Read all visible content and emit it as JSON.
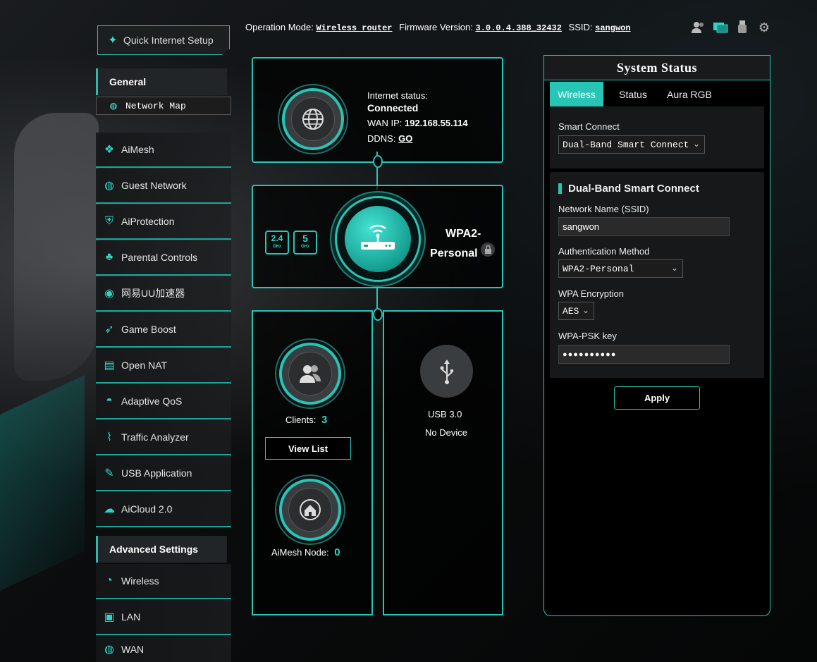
{
  "header": {
    "op_mode_label": "Operation Mode:",
    "op_mode_value": "Wireless router",
    "firmware_label": "Firmware Version:",
    "firmware_value": "3.0.0.4.388_32432",
    "ssid_label": "SSID:",
    "ssid_value": "sangwon",
    "icons": [
      "users-icon",
      "monitor-icon",
      "usb-icon",
      "gear-icon"
    ]
  },
  "menu": {
    "quick_setup": "Quick Internet Setup",
    "general_header": "General",
    "general_items": [
      {
        "label": "Network Map",
        "icon": "globe-icon"
      },
      {
        "label": "AiMesh",
        "icon": "mesh-icon"
      },
      {
        "label": "Guest Network",
        "icon": "guest-globe-icon"
      },
      {
        "label": "AiProtection",
        "icon": "shield-icon"
      },
      {
        "label": "Parental Controls",
        "icon": "family-icon"
      },
      {
        "label": "网易UU加速器",
        "icon": "uu-icon"
      },
      {
        "label": "Game Boost",
        "icon": "rocket-icon"
      },
      {
        "label": "Open NAT",
        "icon": "nat-icon"
      },
      {
        "label": "Adaptive QoS",
        "icon": "gauge-icon"
      },
      {
        "label": "Traffic Analyzer",
        "icon": "traffic-icon"
      },
      {
        "label": "USB Application",
        "icon": "usb-app-icon"
      },
      {
        "label": "AiCloud 2.0",
        "icon": "cloud-icon"
      }
    ],
    "advanced_header": "Advanced Settings",
    "advanced_items": [
      {
        "label": "Wireless",
        "icon": "wifi-icon"
      },
      {
        "label": "LAN",
        "icon": "lan-icon"
      },
      {
        "label": "WAN",
        "icon": "wan-globe-icon"
      }
    ]
  },
  "network_map": {
    "internet_status_label": "Internet status:",
    "internet_status_value": "Connected",
    "wan_ip_label": "WAN IP:",
    "wan_ip_value": "192.168.55.114",
    "ddns_label": "DDNS:",
    "ddns_value": "GO",
    "band_24": "2.4",
    "band_24_unit": "GHz",
    "band_5": "5",
    "band_5_unit": "GHz",
    "security_line1": "WPA2-",
    "security_line2": "Personal",
    "clients_label": "Clients:",
    "clients_value": "3",
    "view_list": "View List",
    "aimesh_label": "AiMesh Node:",
    "aimesh_value": "0",
    "usb_label": "USB 3.0",
    "usb_status": "No Device"
  },
  "system_status": {
    "title": "System Status",
    "tabs": [
      "Wireless",
      "Status",
      "Aura RGB"
    ],
    "smart_connect_label": "Smart Connect",
    "smart_connect_value": "Dual-Band Smart Connect",
    "section_title": "Dual-Band Smart Connect",
    "ssid_label": "Network Name (SSID)",
    "ssid_value": "sangwon",
    "auth_label": "Authentication Method",
    "auth_value": "WPA2-Personal",
    "enc_label": "WPA Encryption",
    "enc_value": "AES",
    "psk_label": "WPA-PSK key",
    "psk_value": "●●●●●●●●●●",
    "apply": "Apply"
  },
  "colors": {
    "accent": "#27c5b5",
    "accent_bright": "#2fd5c4",
    "panel": "#171819"
  }
}
